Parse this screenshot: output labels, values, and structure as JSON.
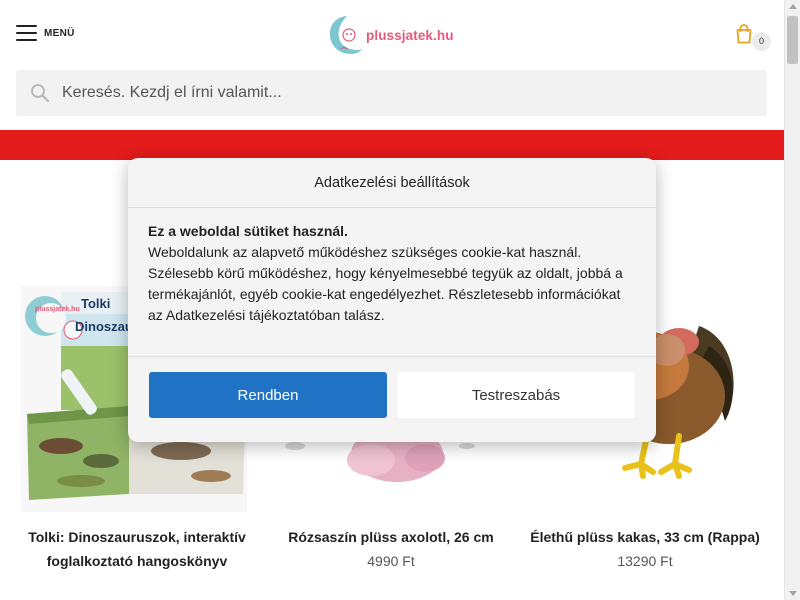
{
  "header": {
    "menu_label": "MENÜ",
    "logo_text": "plussjatek.hu",
    "cart_count": "0"
  },
  "search": {
    "placeholder": "Keresés. Kezdj el írni valamit..."
  },
  "colors": {
    "accent_red": "#e31b1b",
    "primary_button": "#1f72c4",
    "logo_pink": "#e45a7a",
    "cart_gold": "#e6a020"
  },
  "products": [
    {
      "title": "Tolki: Dinoszauruszok, interaktív foglalkoztató hangoskönyv",
      "price": "",
      "image_badge_text": "plussjatek.hu",
      "book_brand": "Tolki",
      "book_title": "Dinoszaurusz"
    },
    {
      "title": "Rózsaszín plüss axolotl, 26 cm",
      "price": "4990 Ft"
    },
    {
      "title": "Élethű plüss kakas, 33 cm (Rappa)",
      "price": "13290 Ft"
    }
  ],
  "cookie_modal": {
    "title": "Adatkezelési beállítások",
    "lead": "Ez a weboldal sütiket használ.",
    "body": "Weboldalunk az alapvető működéshez szükséges cookie-kat használ. Szélesebb körű működéshez, hogy kényelmesebbé tegyük az oldalt, jobbá a termékajánlót, egyéb cookie-kat engedélyezhet. Részletesebb információkat az Adatkezelési tájékoztatóban talász.",
    "accept_label": "Rendben",
    "customize_label": "Testreszabás"
  }
}
